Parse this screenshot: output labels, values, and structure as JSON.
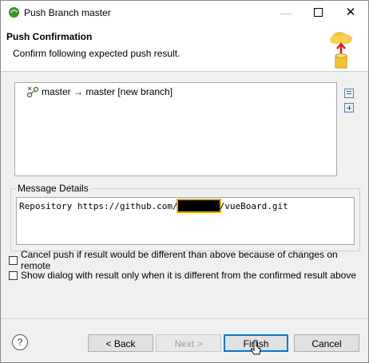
{
  "window": {
    "title": "Push Branch master"
  },
  "header": {
    "title": "Push Confirmation",
    "description": "Confirm following expected push result."
  },
  "result_tree": {
    "rows": [
      {
        "label": "master → master [new branch]",
        "icon": "branch-push-icon"
      }
    ]
  },
  "message_details": {
    "label": "Message Details",
    "text_prefix": "Repository https://github.com/",
    "text_suffix": "/vueBoard.git"
  },
  "options": {
    "cancel_if_different": "Cancel push if result would be different than above because of changes on remote",
    "show_only_if_different": "Show dialog with result only when it is different from the confirmed result above"
  },
  "buttons": {
    "help": "?",
    "back": "< Back",
    "next": "Next >",
    "finish": "Finish",
    "cancel": "Cancel"
  },
  "colors": {
    "accent": "#0078d7",
    "redaction_outline": "#e8a800"
  }
}
